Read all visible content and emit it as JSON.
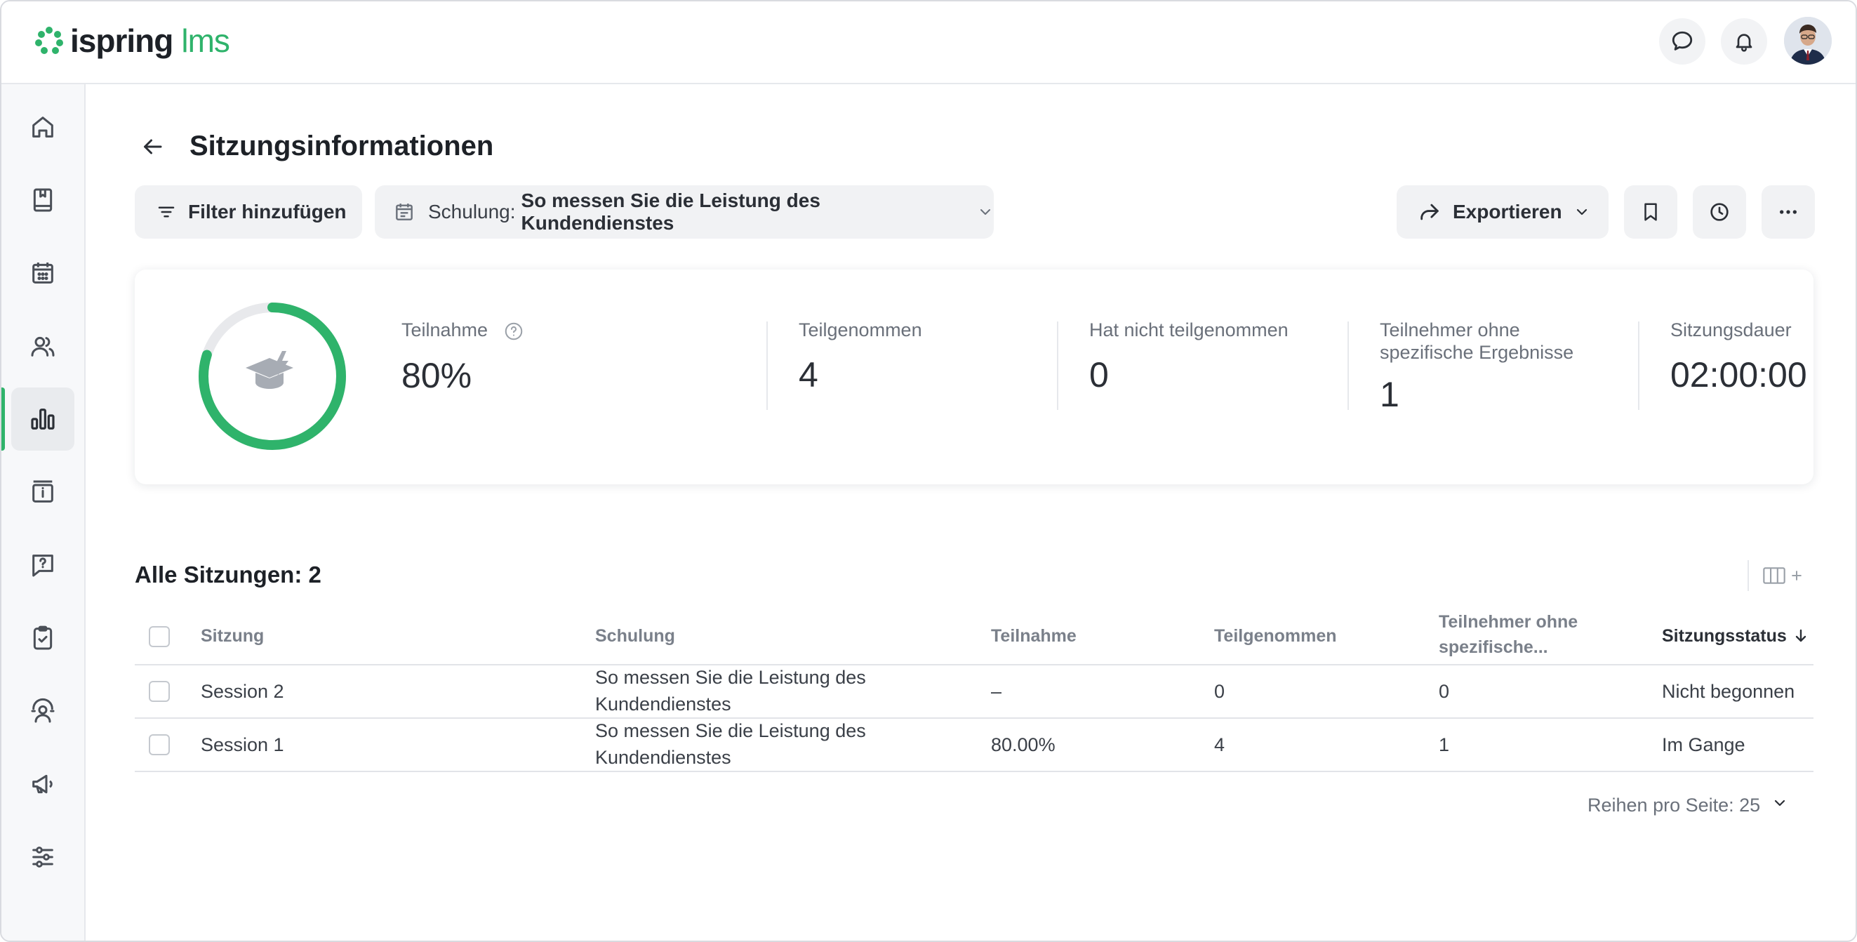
{
  "header": {
    "logo_brand": "ispring",
    "logo_product": "lms"
  },
  "sidebar": {
    "items": [
      {
        "icon": "home-icon"
      },
      {
        "icon": "book-icon"
      },
      {
        "icon": "calendar-icon"
      },
      {
        "icon": "users-icon"
      },
      {
        "icon": "reports-icon",
        "active": true
      },
      {
        "icon": "info-board-icon"
      },
      {
        "icon": "question-icon"
      },
      {
        "icon": "clipboard-check-icon"
      },
      {
        "icon": "coaching-icon"
      },
      {
        "icon": "megaphone-icon"
      },
      {
        "icon": "settings-sliders-icon"
      }
    ]
  },
  "page": {
    "title": "Sitzungsinformationen"
  },
  "toolbar": {
    "filter_label": "Filter hinzufügen",
    "course_prefix": "Schulung:",
    "course_value": "So messen Sie die Leistung des Kundendienstes",
    "export_label": "Exportieren"
  },
  "stats": {
    "attendance_percent": 80,
    "attendance_label": "Teilnahme",
    "attendance_value": "80%",
    "attended_label": "Teilgenommen",
    "attended_value": "4",
    "not_attended_label": "Hat nicht teilgenommen",
    "not_attended_value": "0",
    "no_results_label_line1": "Teilnehmer ohne",
    "no_results_label_line2": "spezifische Ergebnisse",
    "no_results_value": "1",
    "duration_label": "Sitzungsdauer",
    "duration_value": "02:00:00"
  },
  "table": {
    "title": "Alle Sitzungen: 2",
    "headers": {
      "session": "Sitzung",
      "course": "Schulung",
      "attendance": "Teilnahme",
      "attended": "Teilgenommen",
      "no_results_line1": "Teilnehmer ohne",
      "no_results_line2": "spezifische...",
      "status": "Sitzungsstatus"
    },
    "rows": [
      {
        "session": "Session 2",
        "course_line1": "So messen Sie die Leistung des",
        "course_line2": "Kundendienstes",
        "attendance": "–",
        "attended": "0",
        "no_results": "0",
        "status": "Nicht begonnen"
      },
      {
        "session": "Session 1",
        "course_line1": "So messen Sie die Leistung des",
        "course_line2": "Kundendienstes",
        "attendance": "80.00%",
        "attended": "4",
        "no_results": "1",
        "status": "Im Gange"
      }
    ],
    "rows_per_page": "Reihen pro Seite: 25"
  },
  "colors": {
    "accent": "#2fb36b",
    "ring_track": "#e8e9ec"
  }
}
